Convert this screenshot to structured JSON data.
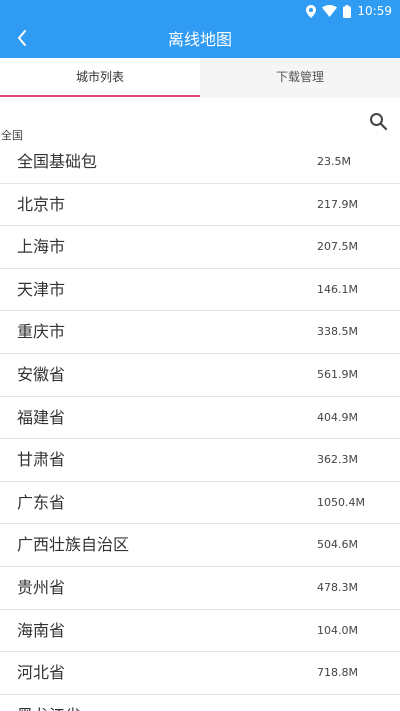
{
  "status_bar": {
    "time": "10:59"
  },
  "header": {
    "title": "离线地图"
  },
  "tabs": [
    {
      "label": "城市列表"
    },
    {
      "label": "下载管理"
    }
  ],
  "section": {
    "label": "全国"
  },
  "items": [
    {
      "name": "全国基础包",
      "size": "23.5M"
    },
    {
      "name": "北京市",
      "size": "217.9M"
    },
    {
      "name": "上海市",
      "size": "207.5M"
    },
    {
      "name": "天津市",
      "size": "146.1M"
    },
    {
      "name": "重庆市",
      "size": "338.5M"
    },
    {
      "name": "安徽省",
      "size": "561.9M"
    },
    {
      "name": "福建省",
      "size": "404.9M"
    },
    {
      "name": "甘肃省",
      "size": "362.3M"
    },
    {
      "name": "广东省",
      "size": "1050.4M"
    },
    {
      "name": "广西壮族自治区",
      "size": "504.6M"
    },
    {
      "name": "贵州省",
      "size": "478.3M"
    },
    {
      "name": "海南省",
      "size": "104.0M"
    },
    {
      "name": "河北省",
      "size": "718.8M"
    },
    {
      "name": "黑龙江省",
      "size": ""
    }
  ],
  "colors": {
    "accent": "#2f9bf2",
    "tab_indicator": "#e8457a"
  }
}
